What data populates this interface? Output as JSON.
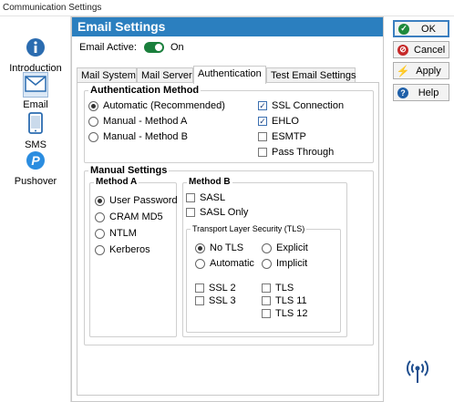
{
  "window": {
    "title": "Communication Settings"
  },
  "sidebar": {
    "items": [
      {
        "label": "Introduction",
        "icon": "info-icon"
      },
      {
        "label": "Email",
        "icon": "envelope-icon"
      },
      {
        "label": "SMS",
        "icon": "phone-icon"
      },
      {
        "label": "Pushover",
        "icon": "pushover-icon"
      }
    ]
  },
  "panel": {
    "title": "Email Settings",
    "email_active_label": "Email Active:",
    "email_active_state": "On"
  },
  "tabs": [
    {
      "label": "Mail System"
    },
    {
      "label": "Mail Server"
    },
    {
      "label": "Authentication"
    },
    {
      "label": "Test Email Settings"
    }
  ],
  "auth_method": {
    "title": "Authentication Method",
    "radios": [
      {
        "label": "Automatic (Recommended)",
        "selected": true
      },
      {
        "label": "Manual - Method A",
        "selected": false
      },
      {
        "label": "Manual - Method B",
        "selected": false
      }
    ],
    "checks": [
      {
        "label": "SSL Connection",
        "checked": true
      },
      {
        "label": "EHLO",
        "checked": true
      },
      {
        "label": "ESMTP",
        "checked": false
      },
      {
        "label": "Pass Through",
        "checked": false
      }
    ]
  },
  "manual": {
    "title": "Manual Settings",
    "method_a": {
      "title": "Method A",
      "radios": [
        {
          "label": "User Password",
          "selected": true
        },
        {
          "label": "CRAM MD5",
          "selected": false
        },
        {
          "label": "NTLM",
          "selected": false
        },
        {
          "label": "Kerberos",
          "selected": false
        }
      ]
    },
    "method_b": {
      "title": "Method B",
      "checks": [
        {
          "label": "SASL",
          "checked": false
        },
        {
          "label": "SASL Only",
          "checked": false
        }
      ],
      "tls": {
        "title": "Transport Layer Security (TLS)",
        "radios": [
          {
            "label": "No TLS",
            "selected": true
          },
          {
            "label": "Explicit",
            "selected": false
          },
          {
            "label": "Automatic",
            "selected": false
          },
          {
            "label": "Implicit",
            "selected": false
          }
        ],
        "checks": [
          {
            "label": "SSL 2",
            "checked": false
          },
          {
            "label": "TLS",
            "checked": false
          },
          {
            "label": "SSL 3",
            "checked": false
          },
          {
            "label": "TLS 11",
            "checked": false
          },
          {
            "label": "TLS 12",
            "checked": false
          }
        ]
      }
    }
  },
  "buttons": [
    {
      "label": "OK",
      "icon": "check-circle-icon",
      "color": "#1e8a3c"
    },
    {
      "label": "Cancel",
      "icon": "no-entry-icon",
      "color": "#c62828"
    },
    {
      "label": "Apply",
      "icon": "lightning-icon",
      "color": "#e0a400"
    },
    {
      "label": "Help",
      "icon": "question-circle-icon",
      "color": "#1f5fa8"
    }
  ],
  "status_icon": "wireless-signal-icon",
  "colors": {
    "accent": "#2b7fbf",
    "toggle_on": "#1a7f3c",
    "signal": "#1f4f8f"
  }
}
